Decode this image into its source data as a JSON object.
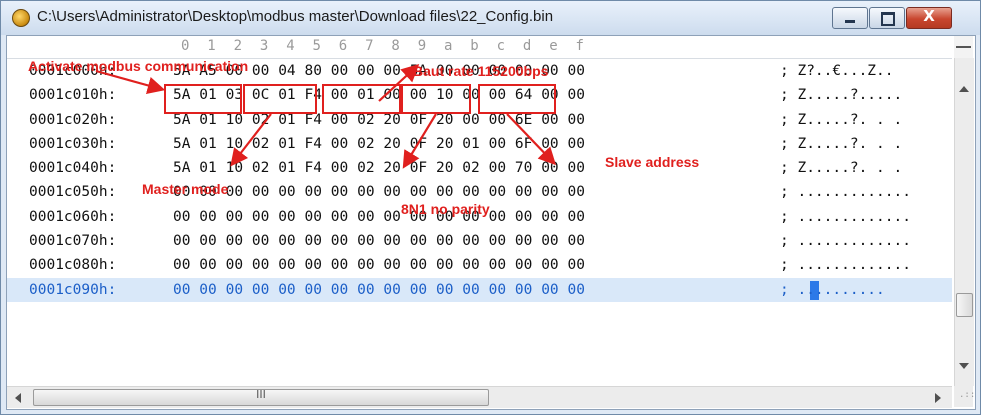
{
  "window": {
    "title": "C:\\Users\\Administrator\\Desktop\\modbus master\\Download files\\22_Config.bin",
    "icon": "app-icon",
    "controls": {
      "close": "X"
    }
  },
  "ruler": [
    "0",
    "1",
    "2",
    "3",
    "4",
    "5",
    "6",
    "7",
    "8",
    "9",
    "a",
    "b",
    "c",
    "d",
    "e",
    "f"
  ],
  "hex_rows": [
    {
      "offset": "0001c000h:",
      "bytes": [
        "5A",
        "A5",
        "00",
        "00",
        "04",
        "80",
        "00",
        "00",
        "00",
        "5A",
        "00",
        "00",
        "00",
        "00",
        "00",
        "00"
      ],
      "ascii": "; Z?..€...Z.."
    },
    {
      "offset": "0001c010h:",
      "bytes": [
        "5A",
        "01",
        "03",
        "0C",
        "01",
        "F4",
        "00",
        "01",
        "00",
        "00",
        "10",
        "00",
        "00",
        "64",
        "00",
        "00"
      ],
      "ascii": "; Z.....?....."
    },
    {
      "offset": "0001c020h:",
      "bytes": [
        "5A",
        "01",
        "10",
        "02",
        "01",
        "F4",
        "00",
        "02",
        "20",
        "0F",
        "20",
        "00",
        "00",
        "6E",
        "00",
        "00"
      ],
      "ascii": "; Z.....?. . ."
    },
    {
      "offset": "0001c030h:",
      "bytes": [
        "5A",
        "01",
        "10",
        "02",
        "01",
        "F4",
        "00",
        "02",
        "20",
        "0F",
        "20",
        "01",
        "00",
        "6F",
        "00",
        "00"
      ],
      "ascii": "; Z.....?. . ."
    },
    {
      "offset": "0001c040h:",
      "bytes": [
        "5A",
        "01",
        "10",
        "02",
        "01",
        "F4",
        "00",
        "02",
        "20",
        "0F",
        "20",
        "02",
        "00",
        "70",
        "00",
        "00"
      ],
      "ascii": "; Z.....?. . ."
    },
    {
      "offset": "0001c050h:",
      "bytes": [
        "00",
        "00",
        "00",
        "00",
        "00",
        "00",
        "00",
        "00",
        "00",
        "00",
        "00",
        "00",
        "00",
        "00",
        "00",
        "00"
      ],
      "ascii": "; ............."
    },
    {
      "offset": "0001c060h:",
      "bytes": [
        "00",
        "00",
        "00",
        "00",
        "00",
        "00",
        "00",
        "00",
        "00",
        "00",
        "00",
        "00",
        "00",
        "00",
        "00",
        "00"
      ],
      "ascii": "; ............."
    },
    {
      "offset": "0001c070h:",
      "bytes": [
        "00",
        "00",
        "00",
        "00",
        "00",
        "00",
        "00",
        "00",
        "00",
        "00",
        "00",
        "00",
        "00",
        "00",
        "00",
        "00"
      ],
      "ascii": "; ............."
    },
    {
      "offset": "0001c080h:",
      "bytes": [
        "00",
        "00",
        "00",
        "00",
        "00",
        "00",
        "00",
        "00",
        "00",
        "00",
        "00",
        "00",
        "00",
        "00",
        "00",
        "00"
      ],
      "ascii": "; ............."
    },
    {
      "offset": "0001c090h:",
      "bytes": [
        "00",
        "00",
        "00",
        "00",
        "00",
        "00",
        "00",
        "00",
        "00",
        "00",
        "00",
        "00",
        "00",
        "00",
        "00",
        "00"
      ],
      "ascii": "; .........."
    }
  ],
  "selected_row": 9,
  "annotations": {
    "activate": "Activate modbus communication",
    "baud": "Baut rate 115200bps",
    "master": "Master mode",
    "parity": "8N1 no parity",
    "slave": "Slave address"
  },
  "hscroll_grip": "III",
  "colors": {
    "annotation": "#e0201e",
    "selection": "#d9e8f9",
    "selection_text": "#1c5fc8"
  }
}
